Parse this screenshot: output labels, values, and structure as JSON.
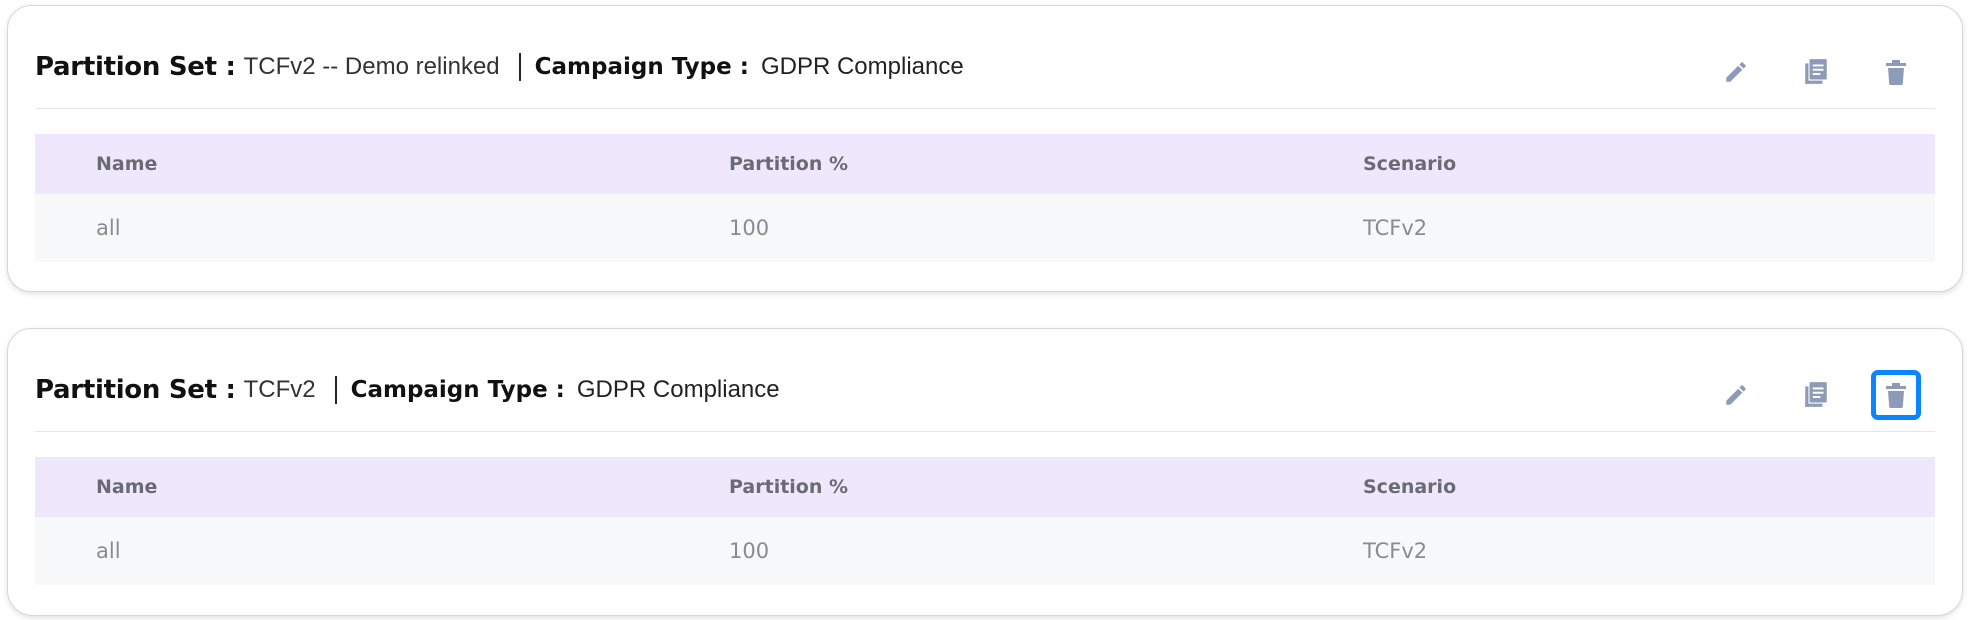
{
  "partition_sets": [
    {
      "partition_set_label": "Partition Set :",
      "partition_set_name": "TCFv2 -- Demo relinked",
      "campaign_type_label": "Campaign Type :",
      "campaign_type_value": "GDPR Compliance",
      "actions": {
        "edit_icon": "pencil-icon",
        "copy_icon": "copy-document-icon",
        "delete_icon": "trash-icon",
        "delete_focused": false
      },
      "table": {
        "headers": [
          "Name",
          "Partition %",
          "Scenario"
        ],
        "rows": [
          [
            "all",
            "100",
            "TCFv2"
          ]
        ]
      }
    },
    {
      "partition_set_label": "Partition Set :",
      "partition_set_name": "TCFv2",
      "campaign_type_label": "Campaign Type :",
      "campaign_type_value": "GDPR Compliance",
      "actions": {
        "edit_icon": "pencil-icon",
        "copy_icon": "copy-document-icon",
        "delete_icon": "trash-icon",
        "delete_focused": true
      },
      "table": {
        "headers": [
          "Name",
          "Partition %",
          "Scenario"
        ],
        "rows": [
          [
            "all",
            "100",
            "TCFv2"
          ]
        ]
      }
    }
  ],
  "colors": {
    "icon": "#8e9bb8",
    "header_row_bg": "#efe8fd",
    "body_row_bg": "#f7f8fa",
    "focus_ring": "#0a84ff"
  }
}
